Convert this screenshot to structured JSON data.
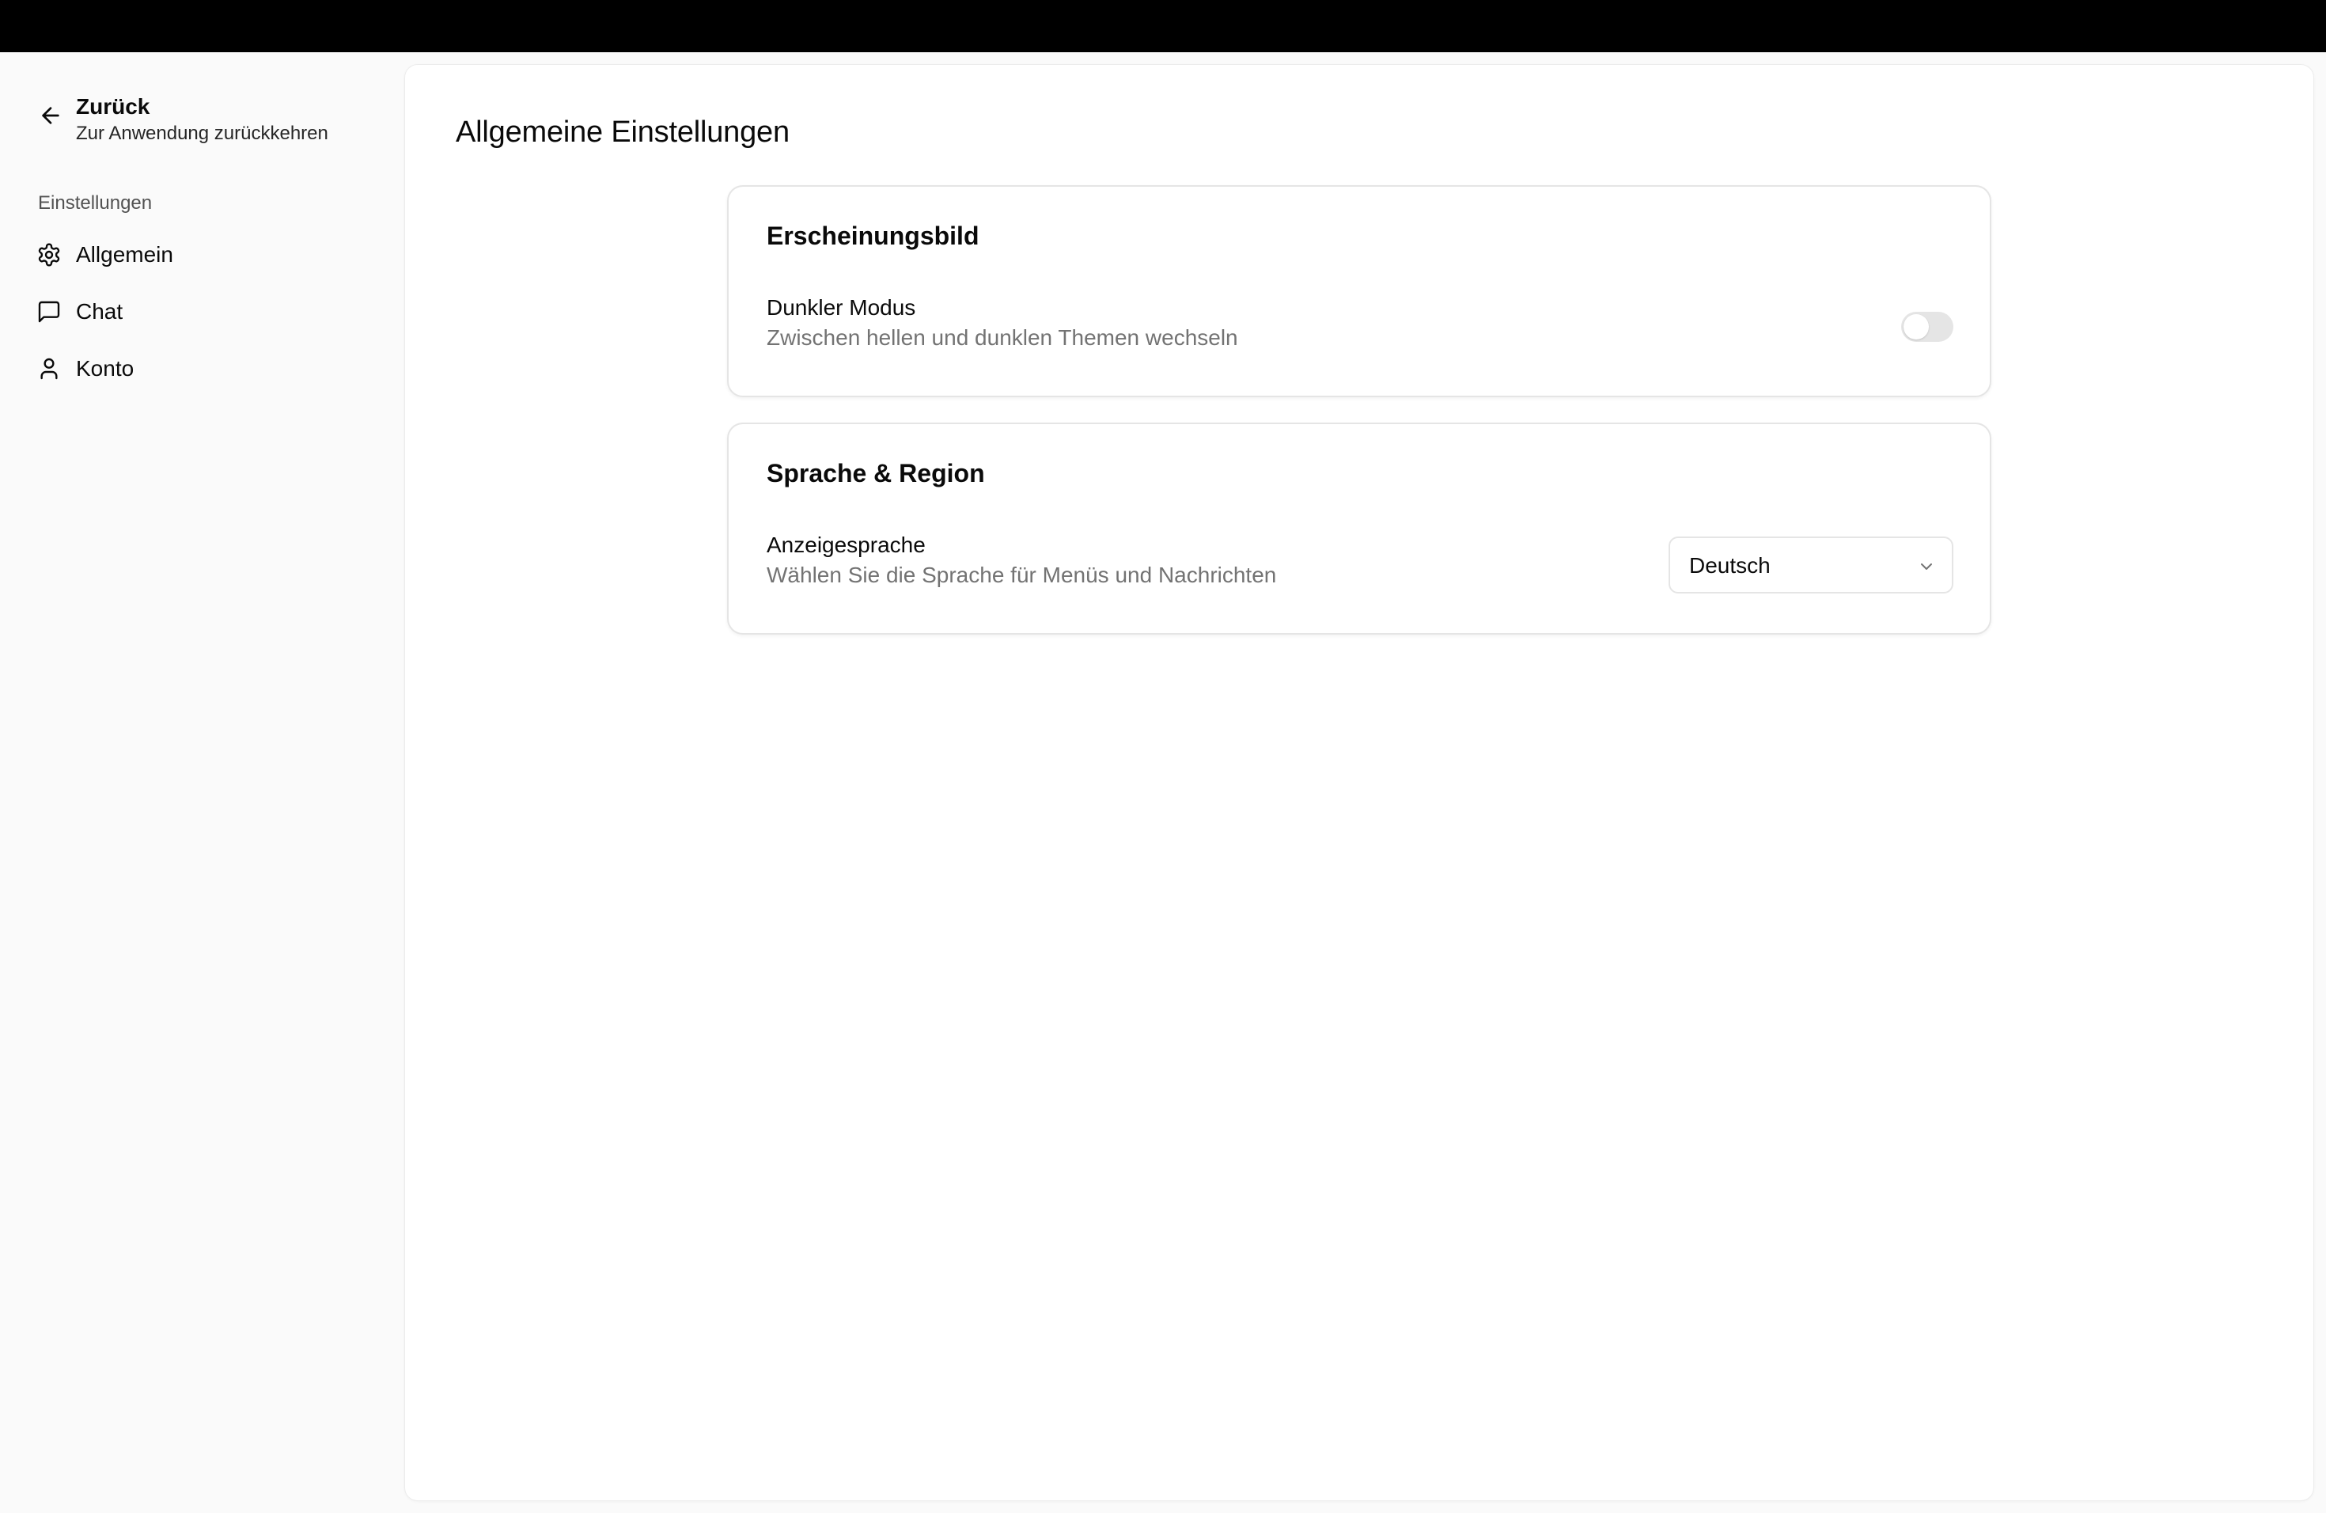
{
  "sidebar": {
    "back": {
      "title": "Zurück",
      "subtitle": "Zur Anwendung zurückkehren",
      "icon": "arrow-left-icon"
    },
    "section_label": "Einstellungen",
    "items": [
      {
        "label": "Allgemein",
        "icon": "gear-icon"
      },
      {
        "label": "Chat",
        "icon": "message-square-icon"
      },
      {
        "label": "Konto",
        "icon": "user-icon"
      }
    ]
  },
  "main": {
    "title": "Allgemeine Einstellungen",
    "cards": [
      {
        "title": "Erscheinungsbild",
        "setting_label": "Dunkler Modus",
        "setting_desc": "Zwischen hellen und dunklen Themen wechseln",
        "toggle_on": false
      },
      {
        "title": "Sprache & Region",
        "setting_label": "Anzeigesprache",
        "setting_desc": "Wählen Sie die Sprache für Menüs und Nachrichten",
        "select_value": "Deutsch",
        "select_icon": "chevron-down-icon"
      }
    ]
  },
  "colors": {
    "topbar": "#000000",
    "sidebar_bg": "#fafafa",
    "card_border": "#e5e5e5",
    "muted_text": "#737373",
    "toggle_off": "#e5e5e5"
  }
}
